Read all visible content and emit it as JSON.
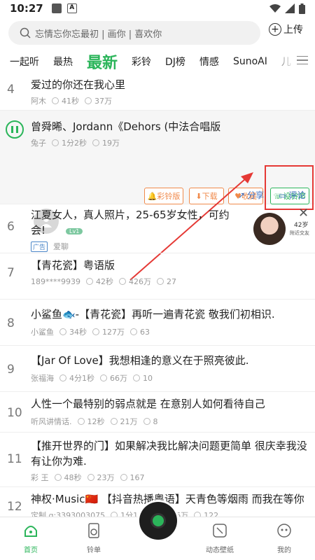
{
  "status": {
    "time": "10:27"
  },
  "search": {
    "placeholder": "忘情忘你忘最初 | 画你 | 喜欢你"
  },
  "upload_label": "上传",
  "tabs": [
    "一起听",
    "最热",
    "最新",
    "彩铃",
    "DJ榜",
    "情感",
    "SunoAI",
    "儿"
  ],
  "songs": [
    {
      "num": "4",
      "title": "爱过的你还在我心里",
      "artist": "阿木",
      "duration": "41秒",
      "plays": "37万"
    },
    {
      "title": "曾舜晞、Jordann《Dehors (中法合唱版",
      "artist": "兔子",
      "duration": "1分2秒",
      "plays": "19万"
    },
    {
      "num": "7",
      "title": "【青花瓷】粤语版",
      "artist": "189****9939",
      "duration": "42秒",
      "plays": "426万",
      "comments": "27"
    },
    {
      "num": "8",
      "title": "小鲨鱼🐟-【青花瓷】再听一遍青花瓷 敬我们初相识.",
      "artist": "小鲨鱼",
      "duration": "34秒",
      "plays": "127万",
      "comments": "63"
    },
    {
      "num": "9",
      "title": "【Jar Of Love】我想相逢的意义在于照亮彼此.",
      "artist": "张福海",
      "duration": "4分1秒",
      "plays": "66万",
      "comments": "10"
    },
    {
      "num": "10",
      "title": "人性一个最特别的弱点就是 在意别人如何看待自己",
      "artist": "听风讲情话.",
      "duration": "12秒",
      "plays": "21万",
      "comments": "8"
    },
    {
      "num": "11",
      "title_line1": "【推开世界的门】如果解决我比解决问题更简单 很庆幸我没",
      "title_line2": "有让你为难.",
      "artist": "彩 王",
      "duration": "48秒",
      "plays": "23万",
      "comments": "167"
    },
    {
      "num": "12",
      "title": "神权·Music🇨🇳 【抖音热播粤语】天青色等烟雨 而我在等你",
      "artist": "定制 q:3393003075",
      "duration": "1分11秒",
      "plays": "476万",
      "comments": "122"
    }
  ],
  "expanded_actions": {
    "ringback": "彩铃版",
    "download": "下载",
    "favorite": "收藏",
    "set_ringtone": "设铃声",
    "share": "分享",
    "comment": "评论",
    "level": "Lv1"
  },
  "ad": {
    "num": "6",
    "line1": "江夏女人，真人照片，25-65岁女性，可约",
    "line2": "会!",
    "tag": "广告",
    "source": "爱聊",
    "age": "42岁",
    "location": "附近交友"
  },
  "bottom_nav": {
    "home": "首页",
    "playlist": "铃单",
    "dynamic": "动态壁纸",
    "mine": "我的"
  },
  "colors": {
    "accent": "#2bb55a",
    "highlight": "#e53935",
    "orange": "#f08a4b"
  }
}
